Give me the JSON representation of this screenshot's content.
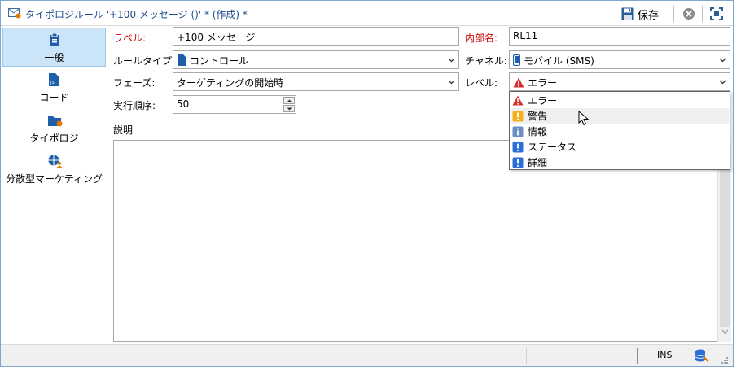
{
  "window": {
    "title": "タイポロジルール '+100 メッセージ ()' * (作成) *",
    "save_label": "保存",
    "accent_color": "#1e4e8c"
  },
  "sidebar": {
    "items": [
      {
        "label": "一般",
        "icon": "clipboard-icon",
        "active": true
      },
      {
        "label": "コード",
        "icon": "js-file-icon"
      },
      {
        "label": "タイポロジ",
        "icon": "typology-folder-icon"
      },
      {
        "label": "分散型マーケティング",
        "icon": "globe-user-icon"
      }
    ]
  },
  "form": {
    "label_label": "ラベル:",
    "label_value": "+100 メッセージ",
    "internal_name_label": "内部名:",
    "internal_name_value": "RL11",
    "rule_type_label": "ルールタイプ:",
    "rule_type_value": "コントロール",
    "channel_label": "チャネル:",
    "channel_value": "モバイル (SMS)",
    "phase_label": "フェーズ:",
    "phase_value": "ターゲティングの開始時",
    "level_label": "レベル:",
    "level_value": "エラー",
    "order_label": "実行順序:",
    "order_value": "50",
    "description_label": "説明"
  },
  "level_dropdown": {
    "options": [
      {
        "label": "エラー",
        "icon": "error-triangle-icon",
        "color": "#d32f2f"
      },
      {
        "label": "警告",
        "icon": "warning-icon",
        "color": "#f2b01e"
      },
      {
        "label": "情報",
        "icon": "info-icon",
        "color": "#6b8fc4"
      },
      {
        "label": "ステータス",
        "icon": "status-icon",
        "color": "#2b6fd6"
      },
      {
        "label": "詳細",
        "icon": "detail-icon",
        "color": "#2b6fd6"
      }
    ],
    "hovered": "警告"
  },
  "statusbar": {
    "mode": "INS"
  }
}
